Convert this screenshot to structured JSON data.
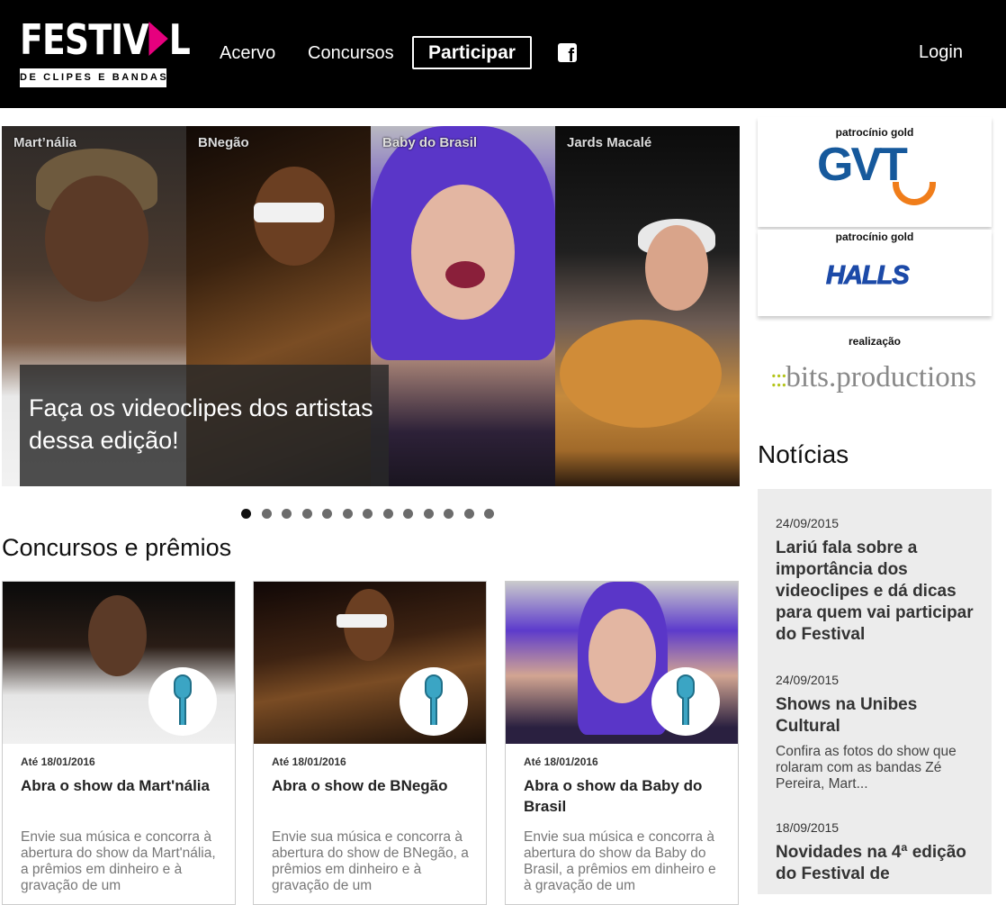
{
  "logo": {
    "top": "FESTIV",
    "top_end": "L",
    "bottom": "DE CLIPES E BANDAS"
  },
  "nav": {
    "acervo": "Acervo",
    "concursos": "Concursos",
    "participar": "Participar",
    "facebook": "f",
    "login": "Login"
  },
  "carousel": {
    "panels": [
      {
        "name": "Mart’nália"
      },
      {
        "name": "BNegão"
      },
      {
        "name": "Baby do Brasil"
      },
      {
        "name": "Jards Macalé"
      }
    ],
    "overlay_text": "Faça os videoclipes dos artistas dessa edição!",
    "dot_count": 13,
    "active_dot": 0
  },
  "contests": {
    "title": "Concursos e prêmios",
    "cards": [
      {
        "date": "Até 18/01/2016",
        "title": "Abra o show da Mart'nália",
        "desc": "Envie sua música e concorra à abertura do show da Mart'nália, a prêmios em dinheiro e à gravação de um"
      },
      {
        "date": "Até 18/01/2016",
        "title": "Abra o show de BNegão",
        "desc": "Envie sua música e concorra à abertura do show de BNegão, a prêmios em dinheiro e à gravação de um"
      },
      {
        "date": "Até 18/01/2016",
        "title": "Abra o show da Baby do Brasil",
        "desc": "Envie sua música e concorra à abertura do show da Baby do Brasil, a prêmios em dinheiro e à gravação de um"
      }
    ]
  },
  "sponsors": [
    {
      "label": "patrocínio gold",
      "brand": "GVT"
    },
    {
      "label": "patrocínio gold",
      "brand": "HALLS"
    },
    {
      "label": "realização",
      "brand": "bits.productions"
    }
  ],
  "news": {
    "title": "Notícias",
    "items": [
      {
        "date": "24/09/2015",
        "headline": "Lariú fala sobre a importância dos videoclipes e dá dicas para quem vai participar do Festival",
        "desc": ""
      },
      {
        "date": "24/09/2015",
        "headline": "Shows na Unibes Cultural",
        "desc": "Confira as fotos do show que rolaram com as bandas Zé Pereira, Mart..."
      },
      {
        "date": "18/09/2015",
        "headline": "Novidades na 4ª edição do Festival de",
        "desc": ""
      }
    ]
  },
  "colors": {
    "accent": "#e6007e",
    "header_bg": "#000000",
    "gvt_blue": "#16599c",
    "gvt_orange": "#f07d1a",
    "halls_blue": "#1c4aa8",
    "bits_green": "#b3c41a"
  },
  "icons": {
    "facebook": "facebook-icon",
    "microphone": "microphone-icon"
  }
}
